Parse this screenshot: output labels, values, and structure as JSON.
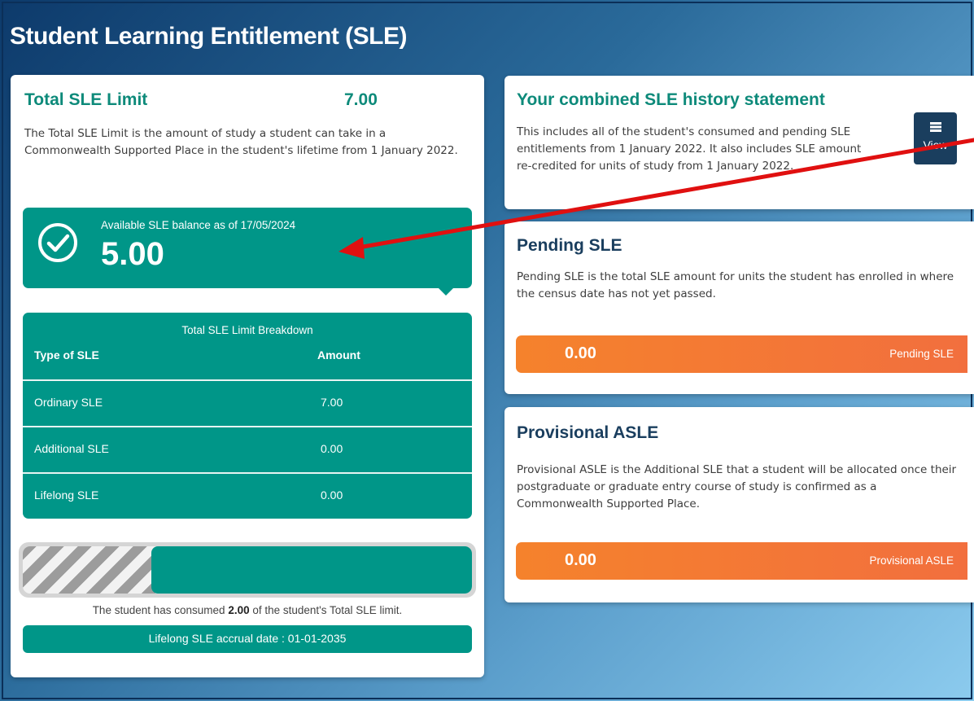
{
  "page": {
    "title": "Student Learning Entitlement (SLE)"
  },
  "total_limit": {
    "title": "Total SLE Limit",
    "value": "7.00",
    "description": "The Total SLE Limit is the amount of study a student can take in a Commonwealth Supported Place in the student's lifetime from 1 January 2022."
  },
  "balance": {
    "label": "Available SLE balance as of 17/05/2024",
    "value": "5.00",
    "icon": "check-circle-icon"
  },
  "breakdown": {
    "caption": "Total SLE Limit Breakdown",
    "col_type": "Type of SLE",
    "col_amount": "Amount",
    "rows": [
      {
        "type": "Ordinary SLE",
        "amount": "7.00"
      },
      {
        "type": "Additional SLE",
        "amount": "0.00"
      },
      {
        "type": "Lifelong SLE",
        "amount": "0.00"
      }
    ]
  },
  "progress": {
    "remaining_fraction": 0.7143,
    "consumed_prefix": "The student has consumed",
    "consumed_value": "2.00",
    "consumed_suffix": "of the student's Total SLE limit."
  },
  "accrual": {
    "text": "Lifelong SLE accrual date : 01-01-2035"
  },
  "history": {
    "title": "Your combined SLE history statement",
    "description": "This includes all of the student's consumed and pending SLE entitlements from 1 January 2022. It also includes SLE amount re-credited for units of study from 1 January 2022.",
    "view_label": "View",
    "view_icon": "list-icon"
  },
  "pending": {
    "title": "Pending SLE",
    "description": "Pending SLE is the total SLE amount for units the student has enrolled in where the census date has not yet passed.",
    "value": "0.00",
    "label": "Pending SLE"
  },
  "provisional": {
    "title": "Provisional ASLE",
    "description": "Provisional ASLE is the Additional SLE that a student will be allocated once their postgraduate or graduate entry course of study is confirmed as a Commonwealth Supported Place.",
    "value": "0.00",
    "label": "Provisional ASLE"
  },
  "colors": {
    "teal": "#009688",
    "navy": "#1a3e5e",
    "orange": "#f5822c",
    "annotation_arrow": "#e01010"
  }
}
